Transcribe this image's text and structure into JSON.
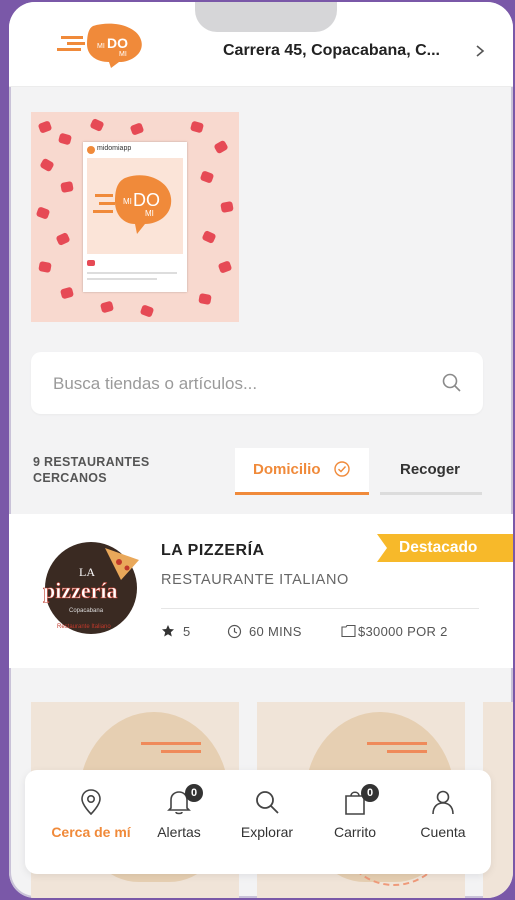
{
  "header": {
    "logo_text": "MIDOMI",
    "address": "Carrera 45, Copacabana, C..."
  },
  "promo": {
    "handle": "midomiapp"
  },
  "search": {
    "placeholder": "Busca tiendas o artículos..."
  },
  "filters": {
    "count_label": "9 RESTAURANTES CERCANOS",
    "delivery_label": "Domicilio",
    "pickup_label": "Recoger"
  },
  "restaurant": {
    "name": "LA PIZZERÍA",
    "type": "RESTAURANTE ITALIANO",
    "rating": "5",
    "time": "60 MINS",
    "price": "$30000 POR 2",
    "badge": "Destacado",
    "logo_text": "LA pizzería"
  },
  "nav": {
    "items": [
      {
        "label": "Cerca de mí",
        "icon": "location-pin-icon"
      },
      {
        "label": "Alertas",
        "icon": "bell-icon",
        "badge": "0"
      },
      {
        "label": "Explorar",
        "icon": "search-icon"
      },
      {
        "label": "Carrito",
        "icon": "shopping-bag-icon",
        "badge": "0"
      },
      {
        "label": "Cuenta",
        "icon": "user-icon"
      }
    ]
  },
  "colors": {
    "accent": "#f08a3a",
    "badge_yellow": "#f7b92a",
    "frame": "#7a58a8"
  }
}
